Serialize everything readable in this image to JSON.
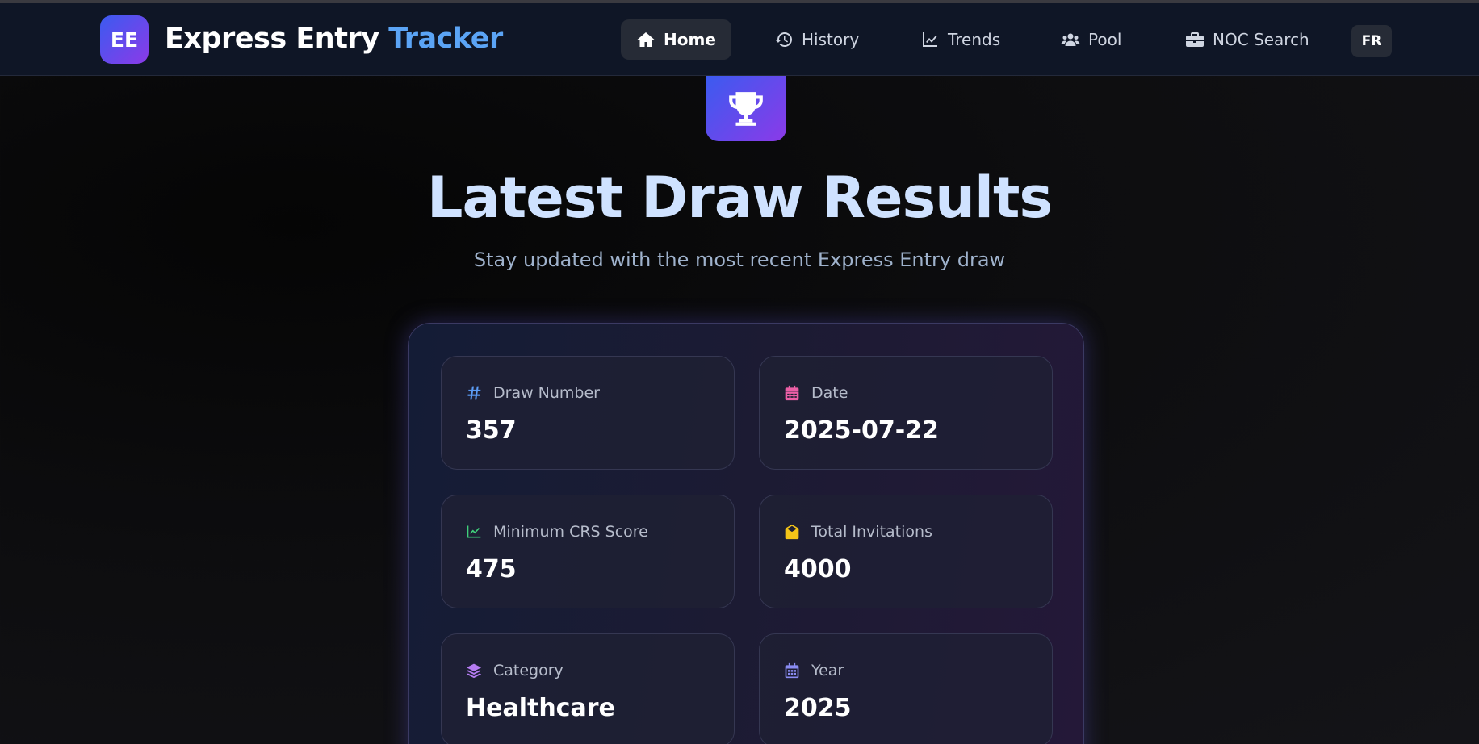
{
  "brand": {
    "badge": "EE",
    "name_part1": "Express Entry",
    "name_part2": "Tracker"
  },
  "nav": {
    "items": [
      {
        "label": "Home",
        "icon": "home-icon",
        "active": true
      },
      {
        "label": "History",
        "icon": "history-icon"
      },
      {
        "label": "Trends",
        "icon": "chart-line-icon"
      },
      {
        "label": "Pool",
        "icon": "users-icon"
      },
      {
        "label": "NOC Search",
        "icon": "briefcase-icon"
      }
    ],
    "language_toggle": "FR"
  },
  "hero": {
    "icon": "trophy-icon",
    "title": "Latest Draw Results",
    "subtitle": "Stay updated with the most recent Express Entry draw"
  },
  "draw": {
    "cards": [
      {
        "label": "Draw Number",
        "value": "357",
        "icon": "hashtag-icon",
        "icon_color": "#5b9cf5"
      },
      {
        "label": "Date",
        "value": "2025-07-22",
        "icon": "calendar-icon",
        "icon_color": "#ec5fa6"
      },
      {
        "label": "Minimum CRS Score",
        "value": "475",
        "icon": "chart-line-icon",
        "icon_color": "#3fcf7a"
      },
      {
        "label": "Total Invitations",
        "value": "4000",
        "icon": "envelope-open-icon",
        "icon_color": "#f5c518"
      },
      {
        "label": "Category",
        "value": "Healthcare",
        "icon": "layers-icon",
        "icon_color": "#b57cf2"
      },
      {
        "label": "Year",
        "value": "2025",
        "icon": "calendar-alt-icon",
        "icon_color": "#8a8cf2"
      }
    ]
  },
  "colors": {
    "accent_blue": "#5ba4f5",
    "gradient_start": "#3b5bf0",
    "gradient_end": "#8b3ae8"
  }
}
